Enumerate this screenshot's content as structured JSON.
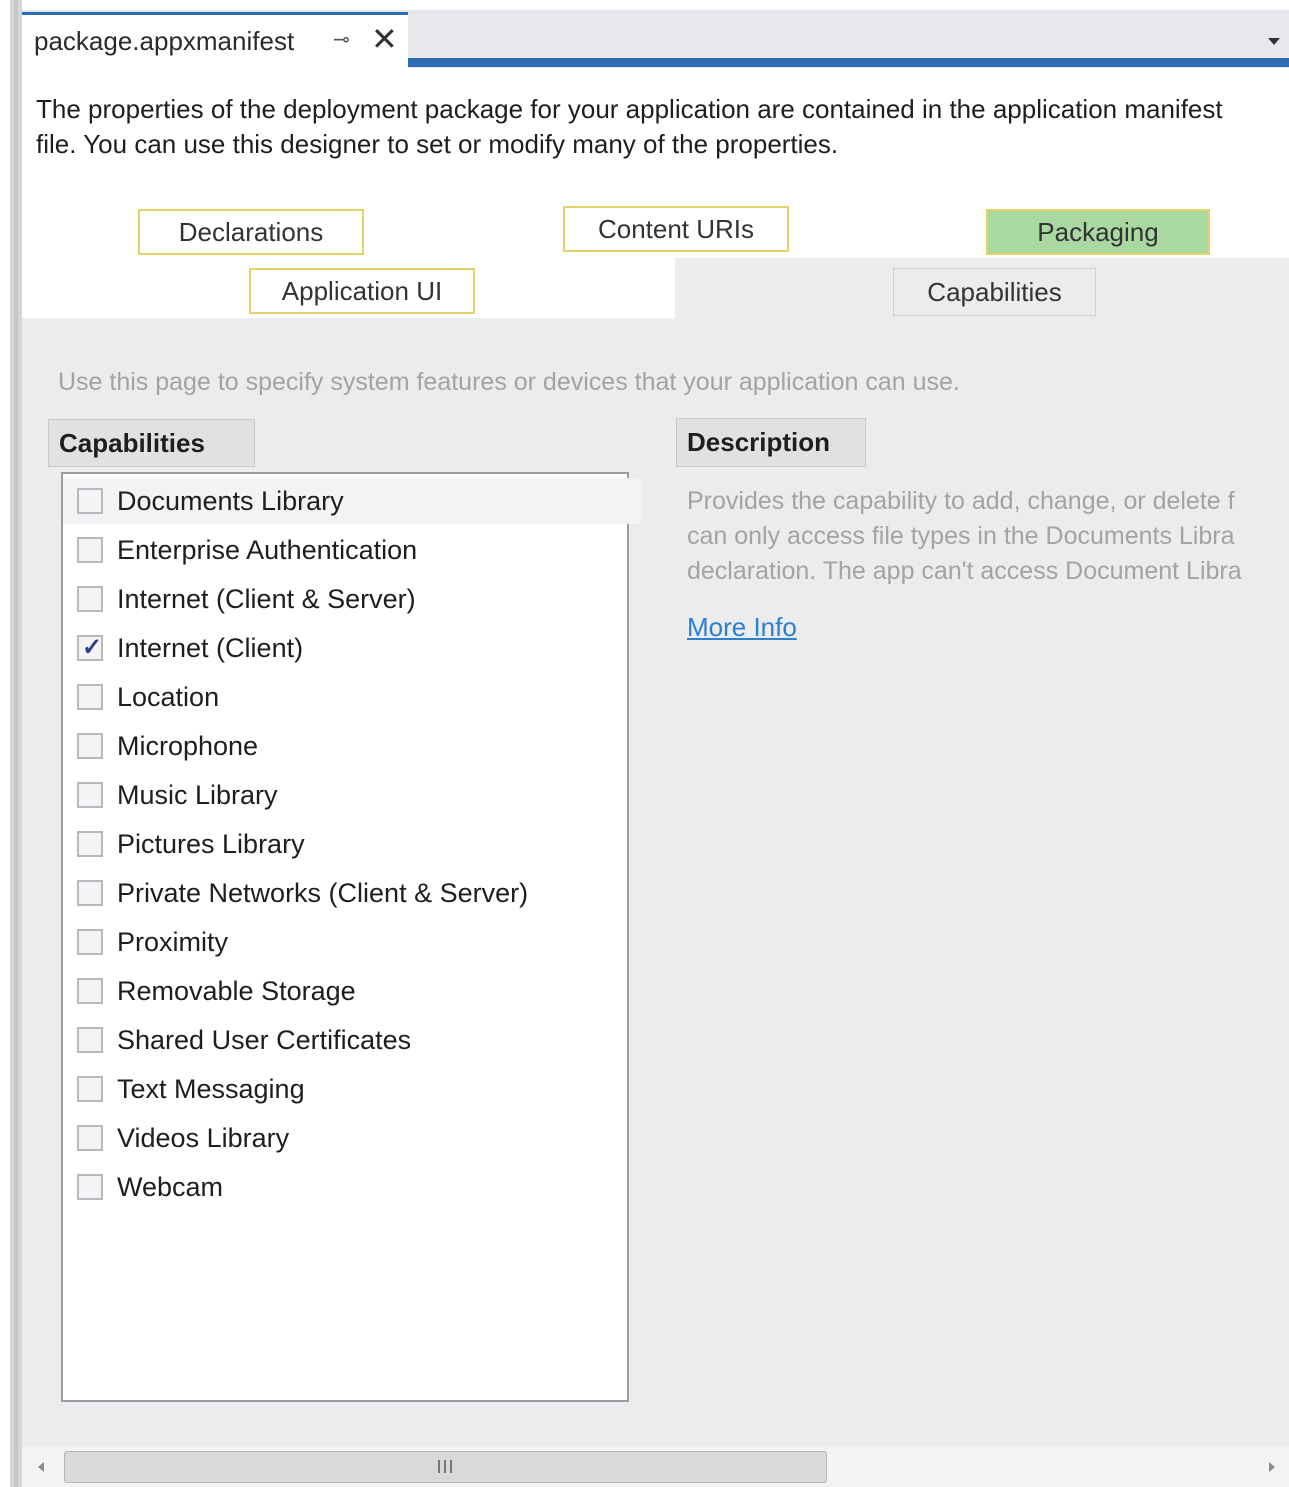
{
  "tab": {
    "title": "package.appxmanifest",
    "pin_glyph": "⊸",
    "close_glyph": "✕"
  },
  "intro": "The properties of the deployment package for your application are contained in the application manifest file. You can use this designer to set or modify many of the properties.",
  "nav": {
    "declarations": "Declarations",
    "content_uris": "Content URIs",
    "packaging": "Packaging",
    "application_ui": "Application UI",
    "capabilities": "Capabilities"
  },
  "page": {
    "hint": "Use this page to specify system features or devices that your application can use.",
    "capabilities_header": "Capabilities",
    "description_header": "Description",
    "description_lines": [
      "Provides the capability to add, change, or delete f",
      "can only access file types in the Documents Libra",
      "declaration. The app can't access Document Libra"
    ],
    "more_info": "More Info"
  },
  "capabilities": [
    {
      "label": "Documents Library",
      "checked": false
    },
    {
      "label": "Enterprise Authentication",
      "checked": false
    },
    {
      "label": "Internet (Client & Server)",
      "checked": false
    },
    {
      "label": "Internet (Client)",
      "checked": true
    },
    {
      "label": "Location",
      "checked": false
    },
    {
      "label": "Microphone",
      "checked": false
    },
    {
      "label": "Music Library",
      "checked": false
    },
    {
      "label": "Pictures Library",
      "checked": false
    },
    {
      "label": "Private Networks (Client & Server)",
      "checked": false
    },
    {
      "label": "Proximity",
      "checked": false
    },
    {
      "label": "Removable Storage",
      "checked": false
    },
    {
      "label": "Shared User Certificates",
      "checked": false
    },
    {
      "label": "Text Messaging",
      "checked": false
    },
    {
      "label": "Videos Library",
      "checked": false
    },
    {
      "label": "Webcam",
      "checked": false
    }
  ],
  "scrollbar": {
    "grip": "III"
  },
  "colors": {
    "accent": "#2d6db5",
    "nav_border": "#e4d36a",
    "packaging_fill": "#a9d8a0",
    "link": "#2d7fd0"
  }
}
